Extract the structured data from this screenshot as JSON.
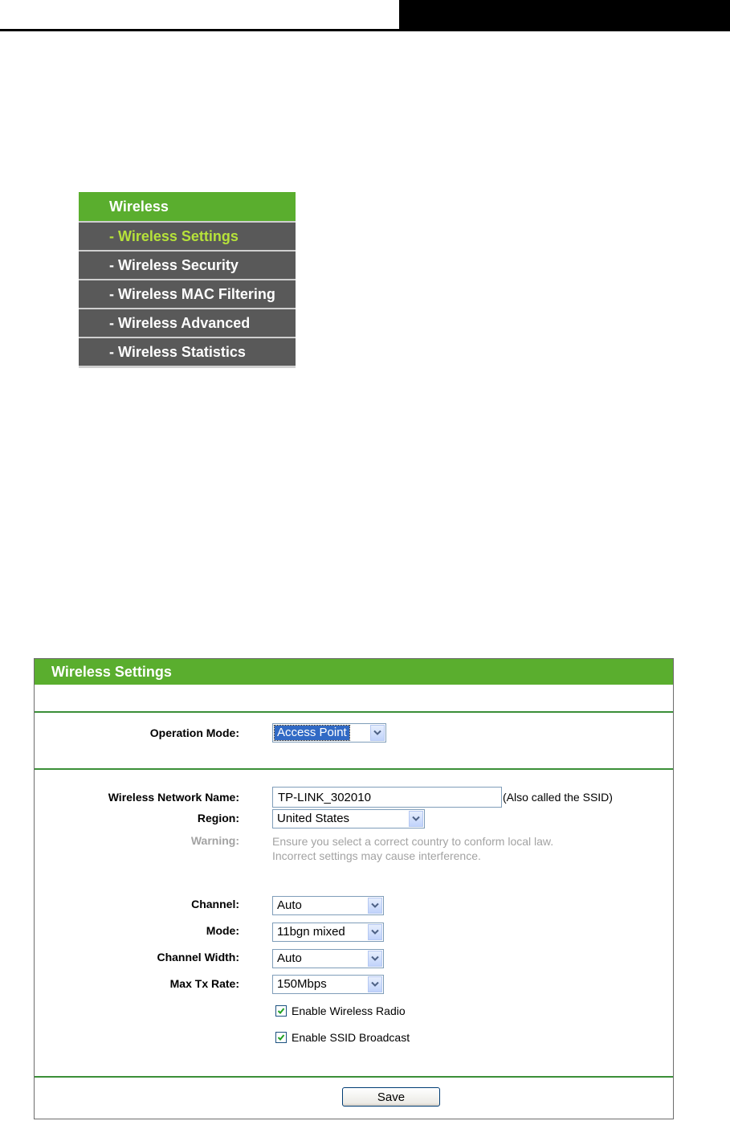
{
  "menu": {
    "title": "Wireless",
    "items": [
      {
        "label": "- Wireless Settings",
        "active": true
      },
      {
        "label": "- Wireless Security",
        "active": false
      },
      {
        "label": "- Wireless MAC Filtering",
        "active": false
      },
      {
        "label": "- Wireless Advanced",
        "active": false
      },
      {
        "label": "- Wireless Statistics",
        "active": false
      }
    ]
  },
  "panel": {
    "title": "Wireless Settings",
    "operation_mode": {
      "label": "Operation Mode:",
      "value": "Access Point"
    },
    "network_name": {
      "label": "Wireless Network Name:",
      "value": "TP-LINK_302010",
      "hint": "(Also called the SSID)"
    },
    "region": {
      "label": "Region:",
      "value": "United States"
    },
    "warning": {
      "label": "Warning:",
      "line1": "Ensure you select a correct country to conform local law.",
      "line2": "Incorrect settings may cause interference."
    },
    "channel": {
      "label": "Channel:",
      "value": "Auto"
    },
    "mode": {
      "label": "Mode:",
      "value": "11bgn mixed"
    },
    "channel_width": {
      "label": "Channel Width:",
      "value": "Auto"
    },
    "max_tx_rate": {
      "label": "Max Tx Rate:",
      "value": "150Mbps"
    },
    "enable_radio": {
      "label": "Enable Wireless Radio",
      "checked": true
    },
    "enable_ssid": {
      "label": "Enable SSID Broadcast",
      "checked": true
    },
    "save_label": "Save"
  },
  "colors": {
    "accent_green": "#5aae2e",
    "menu_gray": "#595959",
    "active_text": "#b6e23a",
    "warning_gray": "#a3a3a3"
  }
}
